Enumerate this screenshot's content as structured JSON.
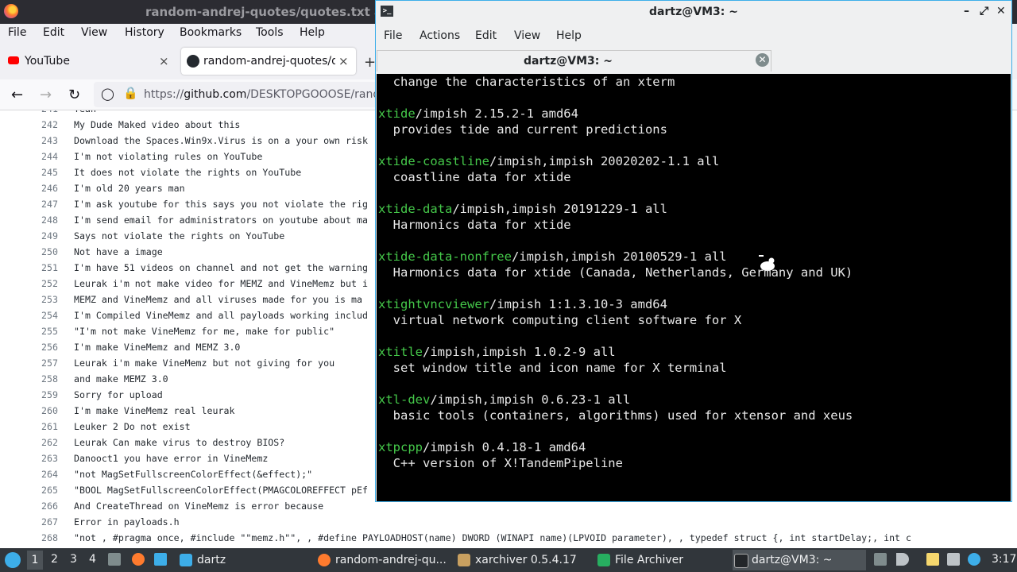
{
  "firefox": {
    "window_title": "random-andrej-quotes/quotes.txt a",
    "menu": [
      "File",
      "Edit",
      "View",
      "History",
      "Bookmarks",
      "Tools",
      "Help"
    ],
    "tabs": [
      {
        "label": "YouTube",
        "close": "×"
      },
      {
        "label": "random-andrej-quotes/qu",
        "close": "×"
      }
    ],
    "new_tab": "+",
    "url_prefix": "https://",
    "url_host": "github.com",
    "url_path": "/DESKTOPGOOOSE/rand",
    "code_lines": [
      {
        "n": "241",
        "t": "Yeah"
      },
      {
        "n": "242",
        "t": "My Dude Maked video about this"
      },
      {
        "n": "243",
        "t": "Download the Spaces.Win9x.Virus is on a your own risk"
      },
      {
        "n": "244",
        "t": "I'm not violating rules on YouTube"
      },
      {
        "n": "245",
        "t": "It does not violate the rights on YouTube"
      },
      {
        "n": "246",
        "t": "I'm old 20 years man"
      },
      {
        "n": "247",
        "t": "I'm ask youtube for this says you not violate the rig"
      },
      {
        "n": "248",
        "t": "I'm send email for administrators on youtube about ma"
      },
      {
        "n": "249",
        "t": "Says not violate the rights on YouTube"
      },
      {
        "n": "250",
        "t": "Not have a image"
      },
      {
        "n": "251",
        "t": "I'm have 51 videos on channel and not get the warning"
      },
      {
        "n": "252",
        "t": "Leurak i'm not make video for MEMZ and VineMemz but i"
      },
      {
        "n": "253",
        "t": "MEMZ and VineMemz and all viruses  made for you is ma"
      },
      {
        "n": "254",
        "t": "I'm Compiled VineMemz and all payloads working includ"
      },
      {
        "n": "255",
        "t": "\"I'm not make VineMemz for me, make for public\""
      },
      {
        "n": "256",
        "t": "I'm make VineMemz and MEMZ 3.0"
      },
      {
        "n": "257",
        "t": "Leurak i'm make VineMemz but not giving for you"
      },
      {
        "n": "258",
        "t": "and make MEMZ 3.0"
      },
      {
        "n": "259",
        "t": "Sorry for upload"
      },
      {
        "n": "260",
        "t": "I'm make VineMemz real leurak"
      },
      {
        "n": "261",
        "t": "Leuker 2 Do not exist"
      },
      {
        "n": "262",
        "t": "Leurak Can make virus to destroy BIOS?"
      },
      {
        "n": "263",
        "t": "Danooct1 you have error in VineMemz"
      },
      {
        "n": "264",
        "t": "\"not MagSetFullscreenColorEffect(&effect);\""
      },
      {
        "n": "265",
        "t": "\"BOOL MagSetFullscreenColorEffect(PMAGCOLOREFFECT pEf"
      },
      {
        "n": "266",
        "t": "And CreateThread on VineMemz is error because"
      },
      {
        "n": "267",
        "t": "Error in payloads.h"
      },
      {
        "n": "268",
        "t": "\"not , #pragma once, #include \"\"memz.h\"\", , #define PAYLOADHOST(name) DWORD (WINAPI name)(LPVOID parameter), , typedef struct {,     int startDelay;,     int c"
      }
    ]
  },
  "terminal": {
    "window_title": "dartz@VM3: ~",
    "menu": [
      "File",
      "Actions",
      "Edit",
      "View",
      "Help"
    ],
    "tab_label": "dartz@VM3: ~",
    "lines": [
      {
        "pkg": "",
        "rest": "  change the characteristics of an xterm"
      },
      {
        "pkg": "",
        "rest": ""
      },
      {
        "pkg": "xtide",
        "rest": "/impish 2.15.2-1 amd64"
      },
      {
        "pkg": "",
        "rest": "  provides tide and current predictions"
      },
      {
        "pkg": "",
        "rest": ""
      },
      {
        "pkg": "xtide-coastline",
        "rest": "/impish,impish 20020202-1.1 all"
      },
      {
        "pkg": "",
        "rest": "  coastline data for xtide"
      },
      {
        "pkg": "",
        "rest": ""
      },
      {
        "pkg": "xtide-data",
        "rest": "/impish,impish 20191229-1 all"
      },
      {
        "pkg": "",
        "rest": "  Harmonics data for xtide"
      },
      {
        "pkg": "",
        "rest": ""
      },
      {
        "pkg": "xtide-data-nonfree",
        "rest": "/impish,impish 20100529-1 all"
      },
      {
        "pkg": "",
        "rest": "  Harmonics data for xtide (Canada, Netherlands, Germany and UK)"
      },
      {
        "pkg": "",
        "rest": ""
      },
      {
        "pkg": "xtightvncviewer",
        "rest": "/impish 1:1.3.10-3 amd64"
      },
      {
        "pkg": "",
        "rest": "  virtual network computing client software for X"
      },
      {
        "pkg": "",
        "rest": ""
      },
      {
        "pkg": "xtitle",
        "rest": "/impish,impish 1.0.2-9 all"
      },
      {
        "pkg": "",
        "rest": "  set window title and icon name for X terminal"
      },
      {
        "pkg": "",
        "rest": ""
      },
      {
        "pkg": "xtl-dev",
        "rest": "/impish,impish 0.6.23-1 all"
      },
      {
        "pkg": "",
        "rest": "  basic tools (containers, algorithms) used for xtensor and xeus"
      },
      {
        "pkg": "",
        "rest": ""
      },
      {
        "pkg": "xtpcpp",
        "rest": "/impish 0.4.18-1 amd64"
      },
      {
        "pkg": "",
        "rest": "  C++ version of X!TandemPipeline"
      }
    ],
    "colors": {
      "pkg": "#45c94a",
      "bg": "#000000",
      "text": "#e8e8e8"
    }
  },
  "taskbar": {
    "workspaces": [
      "1",
      "2",
      "3",
      "4"
    ],
    "folder_label": "dartz",
    "tasks": [
      {
        "label": "random-andrej-qu...",
        "icon": "firefox-icon"
      },
      {
        "label": "xarchiver 0.5.4.17",
        "icon": "xarchiver-icon"
      },
      {
        "label": "File Archiver",
        "icon": "archive-icon"
      },
      {
        "label": "dartz@VM3: ~",
        "icon": "terminal-icon"
      }
    ],
    "clock": "3:17"
  }
}
